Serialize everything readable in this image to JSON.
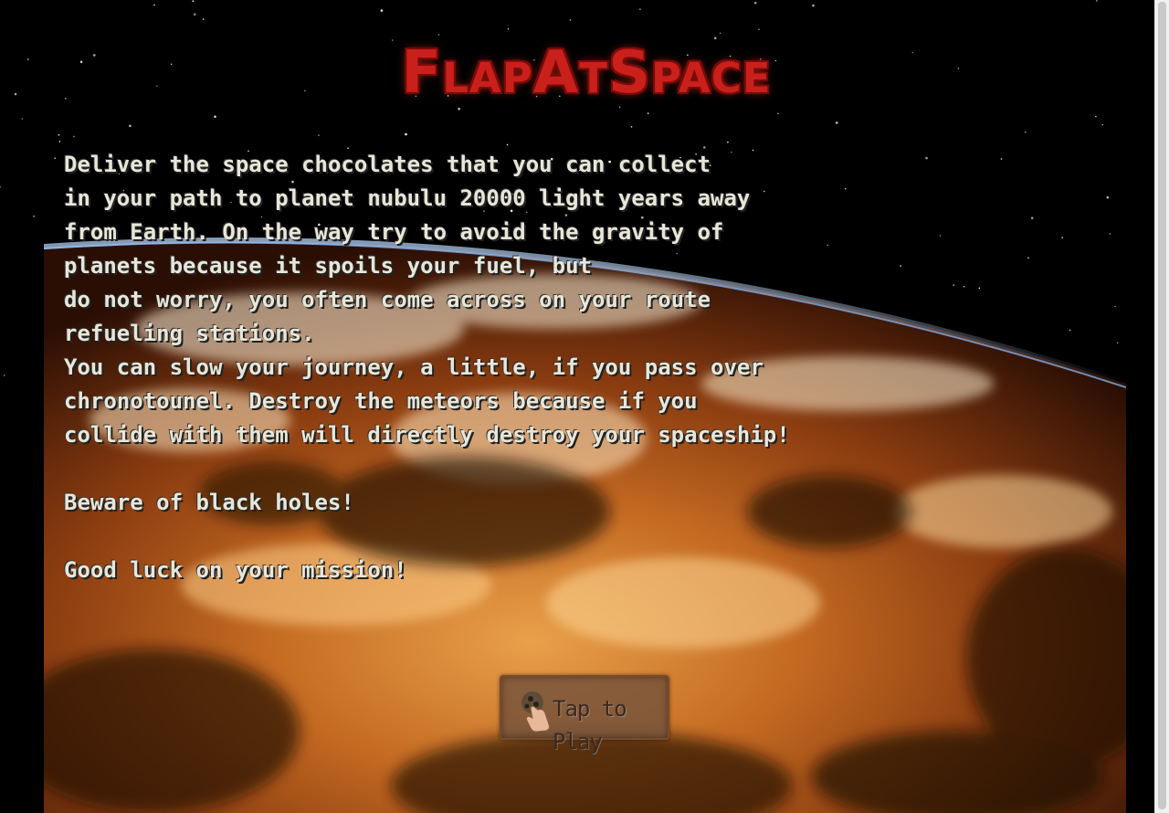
{
  "game": {
    "title": "FlapAtSpace",
    "story_lines": [
      "Deliver the space chocolates that you can collect",
      "in your path to planet nubulu 20000 light years away",
      "from Earth. On the way try to avoid the gravity of",
      "planets because it spoils your fuel, but",
      "do not worry, you often come across on your route",
      "refueling stations.",
      "You can slow your journey, a little, if you pass over",
      "chronotounel. Destroy the meteors because if you",
      "collide with them will directly destroy your spaceship!",
      "",
      "Beware of black holes!",
      "",
      "Good luck on your mission!"
    ],
    "play_button": {
      "label": "Tap to Play",
      "icon": "tap-hand-icon"
    }
  },
  "colors": {
    "background": "#000000",
    "title": "#c9201c",
    "story_text": "#e8e6d8",
    "button_bg": "#785539"
  }
}
